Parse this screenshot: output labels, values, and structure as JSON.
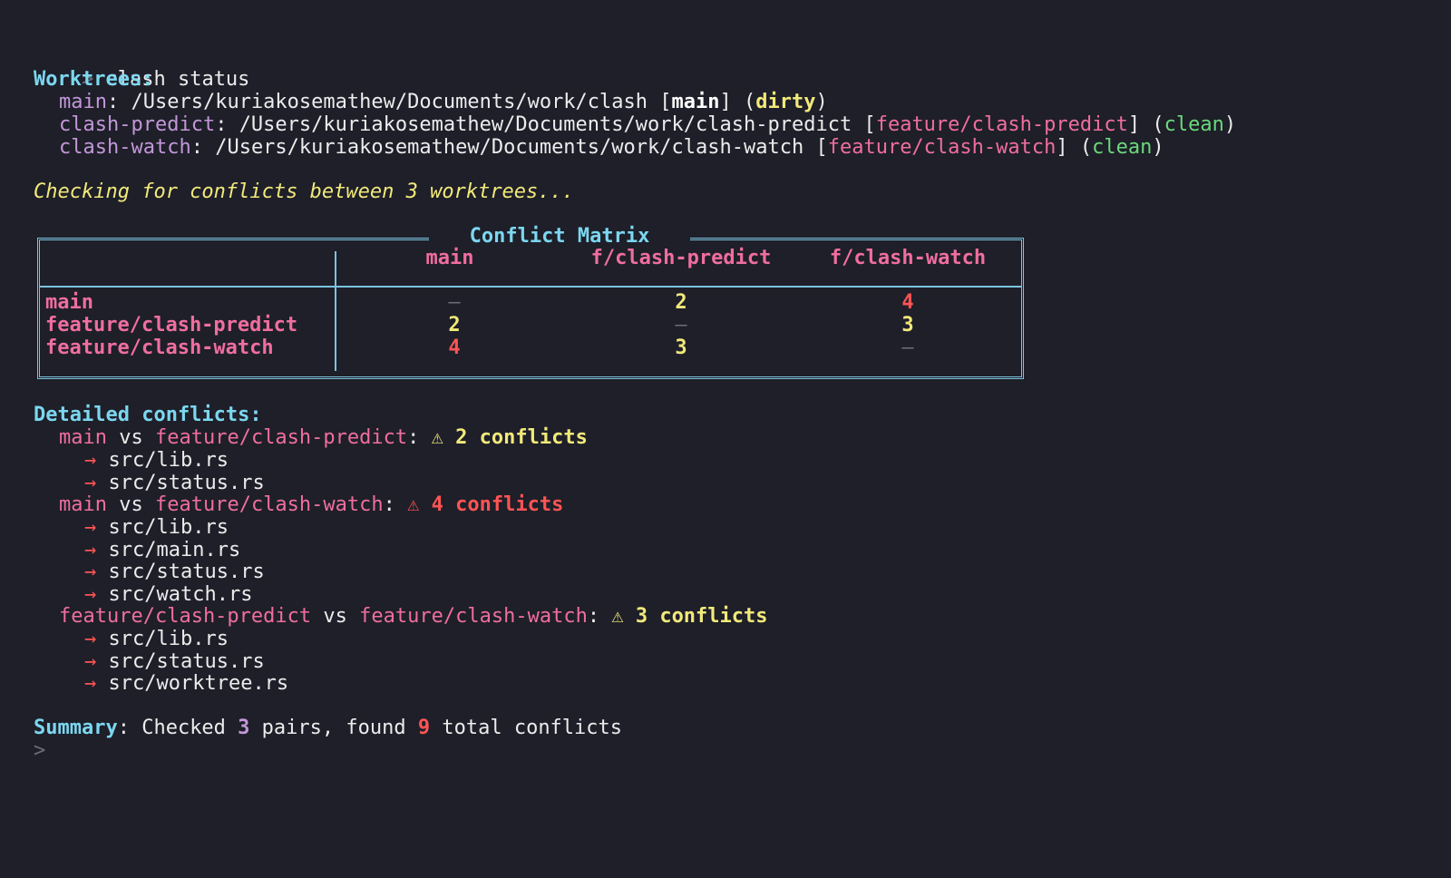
{
  "prompt": {
    "symbol": ">",
    "command": "clash status"
  },
  "worktrees": {
    "heading": "Worktrees:",
    "items": [
      {
        "name": "main",
        "path": "/Users/kuriakosemathew/Documents/work/clash",
        "branch": "main",
        "state": "dirty"
      },
      {
        "name": "clash-predict",
        "path": "/Users/kuriakosemathew/Documents/work/clash-predict",
        "branch": "feature/clash-predict",
        "state": "clean"
      },
      {
        "name": "clash-watch",
        "path": "/Users/kuriakosemathew/Documents/work/clash-watch",
        "branch": "feature/clash-watch",
        "state": "clean"
      }
    ]
  },
  "checking": "Checking for conflicts between 3 worktrees...",
  "matrix": {
    "title": "Conflict Matrix",
    "columns": [
      "main",
      "f/clash-predict",
      "f/clash-watch"
    ],
    "rows": [
      {
        "label": "main",
        "cells": [
          "–",
          "2",
          "4"
        ]
      },
      {
        "label": "feature/clash-predict",
        "cells": [
          "2",
          "–",
          "3"
        ]
      },
      {
        "label": "feature/clash-watch",
        "cells": [
          "4",
          "3",
          "–"
        ]
      }
    ]
  },
  "detailed": {
    "heading": "Detailed conflicts:",
    "pairs": [
      {
        "a": "main",
        "vs": "vs",
        "b": "feature/clash-predict",
        "warn": "⚠",
        "summary": "2 conflicts",
        "files": [
          "src/lib.rs",
          "src/status.rs"
        ]
      },
      {
        "a": "main",
        "vs": "vs",
        "b": "feature/clash-watch",
        "warn": "⚠",
        "summary": "4 conflicts",
        "files": [
          "src/lib.rs",
          "src/main.rs",
          "src/status.rs",
          "src/watch.rs"
        ]
      },
      {
        "a": "feature/clash-predict",
        "vs": "vs",
        "b": "feature/clash-watch",
        "warn": "⚠",
        "summary": "3 conflicts",
        "files": [
          "src/lib.rs",
          "src/status.rs",
          "src/worktree.rs"
        ]
      }
    ],
    "arrow": "→"
  },
  "summary": {
    "label": "Summary",
    "pre": ": Checked ",
    "pairs": "3",
    "mid": " pairs, found ",
    "total": "9",
    "post": " total conflicts"
  },
  "colors": {
    "background": "#1e1f29",
    "cyan": "#7cd7f0",
    "purple": "#c397d8",
    "pink": "#f06e9f",
    "yellow": "#f2e97a",
    "green": "#6bd97a",
    "red": "#ff5454"
  }
}
